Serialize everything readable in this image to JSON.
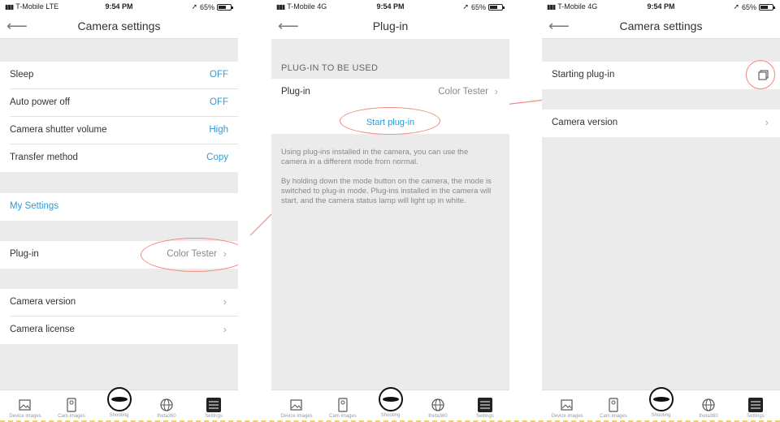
{
  "screens": [
    {
      "status": {
        "carrier": "T-Mobile  LTE",
        "time": "9:54 PM",
        "battery": "65%"
      },
      "title": "Camera settings",
      "rows": [
        {
          "label": "Sleep",
          "value": "OFF"
        },
        {
          "label": "Auto power off",
          "value": "OFF"
        },
        {
          "label": "Camera shutter volume",
          "value": "High"
        },
        {
          "label": "Transfer method",
          "value": "Copy"
        }
      ],
      "my_settings": "My Settings",
      "plugin": {
        "label": "Plug-in",
        "value": "Color Tester"
      },
      "camera_version": "Camera version",
      "camera_license": "Camera license"
    },
    {
      "status": {
        "carrier": "T-Mobile  4G",
        "time": "9:54 PM",
        "battery": "65%"
      },
      "title": "Plug-in",
      "section_head": "PLUG-IN TO BE USED",
      "plugin": {
        "label": "Plug-in",
        "value": "Color Tester"
      },
      "start_label": "Start plug-in",
      "desc1": "Using plug-ins installed in the camera, you can use the camera in a different mode from normal.",
      "desc2": "By holding down the mode button on the camera, the mode is switched to plug-in mode. Plug-ins installed in the camera will start, and the camera status lamp will light up in white."
    },
    {
      "status": {
        "carrier": "T-Mobile  4G",
        "time": "9:54 PM",
        "battery": "65%"
      },
      "title": "Camera settings",
      "starting_plugin": "Starting plug-in",
      "camera_version": "Camera version"
    }
  ],
  "tabs": [
    "Device images",
    "Cam images",
    "Shooting",
    "theta360",
    "Settings"
  ],
  "icons": {
    "back": "arrow-left-icon",
    "chevron": "chevron-right-icon",
    "copy": "copy-icon",
    "device_images": "image-icon",
    "cam_images": "camera-image-icon",
    "shooting": "shutter-icon",
    "theta360": "globe-icon",
    "settings": "sliders-icon"
  },
  "colors": {
    "accent": "#2d9bd6",
    "annotation": "#f08a7a",
    "background": "#ebebeb"
  }
}
